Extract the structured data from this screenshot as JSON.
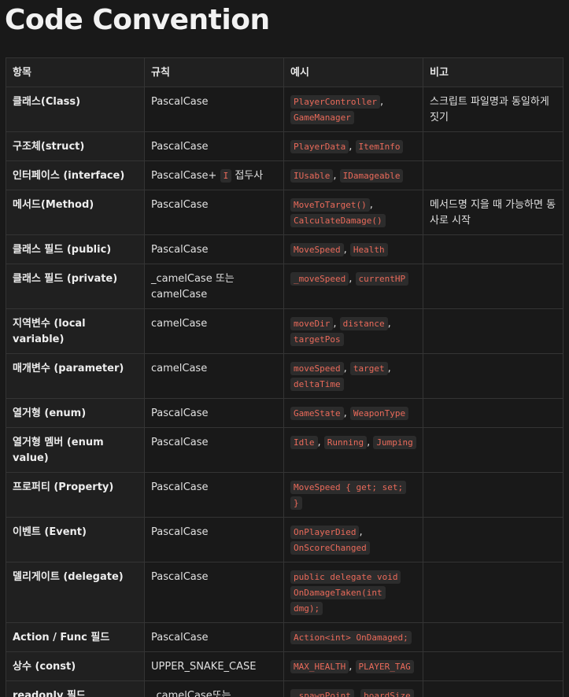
{
  "page": {
    "title": "Code Convention"
  },
  "table": {
    "headers": [
      "항목",
      "규칙",
      "예시",
      "비고"
    ],
    "rows": [
      {
        "item": "클래스(Class)",
        "rule": [
          {
            "t": "PascalCase"
          }
        ],
        "examples": [
          {
            "code": "PlayerController"
          },
          {
            "sep": ", "
          },
          {
            "code": "GameManager"
          }
        ],
        "note": "스크립트 파일명과 동일하게 짓기"
      },
      {
        "item": "구조체(struct)",
        "rule": [
          {
            "t": "PascalCase"
          }
        ],
        "examples": [
          {
            "code": "PlayerData"
          },
          {
            "sep": ", "
          },
          {
            "code": "ItemInfo"
          }
        ],
        "note": ""
      },
      {
        "item": "인터페이스 (interface)",
        "rule": [
          {
            "t": "PascalCase+ "
          },
          {
            "code": "I"
          },
          {
            "t": " 접두사"
          }
        ],
        "examples": [
          {
            "code": "IUsable"
          },
          {
            "sep": ", "
          },
          {
            "code": "IDamageable"
          }
        ],
        "note": ""
      },
      {
        "item": "메서드(Method)",
        "rule": [
          {
            "t": "PascalCase"
          }
        ],
        "examples": [
          {
            "code": "MoveToTarget()"
          },
          {
            "sep": ", "
          },
          {
            "code": "CalculateDamage()"
          }
        ],
        "note": "메서드명 지을 때 가능하면 동사로 시작"
      },
      {
        "item": "클래스 필드 (public)",
        "rule": [
          {
            "t": "PascalCase"
          }
        ],
        "examples": [
          {
            "code": "MoveSpeed"
          },
          {
            "sep": ", "
          },
          {
            "code": "Health"
          }
        ],
        "note": ""
      },
      {
        "item": "클래스 필드 (private)",
        "rule": [
          {
            "t": "_camelCase 또는 camelCase"
          }
        ],
        "examples": [
          {
            "code": "_moveSpeed"
          },
          {
            "sep": ", "
          },
          {
            "code": "currentHP"
          }
        ],
        "note": ""
      },
      {
        "item": "지역변수 (local variable)",
        "rule": [
          {
            "t": "camelCase"
          }
        ],
        "examples": [
          {
            "code": "moveDir"
          },
          {
            "sep": ", "
          },
          {
            "code": "distance"
          },
          {
            "sep": ", "
          },
          {
            "code": "targetPos"
          }
        ],
        "note": ""
      },
      {
        "item": "매개변수 (parameter)",
        "rule": [
          {
            "t": "camelCase"
          }
        ],
        "examples": [
          {
            "code": "moveSpeed"
          },
          {
            "sep": ", "
          },
          {
            "code": "target"
          },
          {
            "sep": ", "
          },
          {
            "code": "deltaTime"
          }
        ],
        "note": ""
      },
      {
        "item": "열거형 (enum)",
        "rule": [
          {
            "t": "PascalCase"
          }
        ],
        "examples": [
          {
            "code": "GameState"
          },
          {
            "sep": ", "
          },
          {
            "code": "WeaponType"
          }
        ],
        "note": ""
      },
      {
        "item": "열거형 멤버 (enum value)",
        "rule": [
          {
            "t": "PascalCase"
          }
        ],
        "examples": [
          {
            "code": "Idle"
          },
          {
            "sep": ", "
          },
          {
            "code": "Running"
          },
          {
            "sep": ", "
          },
          {
            "code": "Jumping"
          }
        ],
        "note": ""
      },
      {
        "item": "프로퍼티 (Property)",
        "rule": [
          {
            "t": "PascalCase"
          }
        ],
        "examples": [
          {
            "code": "MoveSpeed { get; set; }"
          }
        ],
        "note": ""
      },
      {
        "item": "이벤트 (Event)",
        "rule": [
          {
            "t": "PascalCase"
          }
        ],
        "examples": [
          {
            "code": "OnPlayerDied"
          },
          {
            "sep": ", "
          },
          {
            "code": "OnScoreChanged"
          }
        ],
        "note": ""
      },
      {
        "item": "델리게이트 (delegate)",
        "rule": [
          {
            "t": "PascalCase"
          }
        ],
        "examples": [
          {
            "code": "public delegate void OnDamageTaken(int dmg);"
          }
        ],
        "note": ""
      },
      {
        "item": "Action / Func 필드",
        "rule": [
          {
            "t": "PascalCase"
          }
        ],
        "examples": [
          {
            "code": "Action<int> OnDamaged;"
          }
        ],
        "note": ""
      },
      {
        "item": "상수 (const)",
        "rule": [
          {
            "t": "UPPER_SNAKE_CASE"
          }
        ],
        "examples": [
          {
            "code": "MAX_HEALTH"
          },
          {
            "sep": ", "
          },
          {
            "code": "PLAYER_TAG"
          }
        ],
        "note": ""
      },
      {
        "item": "readonly 필드",
        "rule": [
          {
            "t": "_camelCase또는 camelCase"
          }
        ],
        "examples": [
          {
            "code": "_spawnPoint"
          },
          {
            "sep": ", "
          },
          {
            "code": "boardSize"
          }
        ],
        "note": ""
      }
    ]
  }
}
